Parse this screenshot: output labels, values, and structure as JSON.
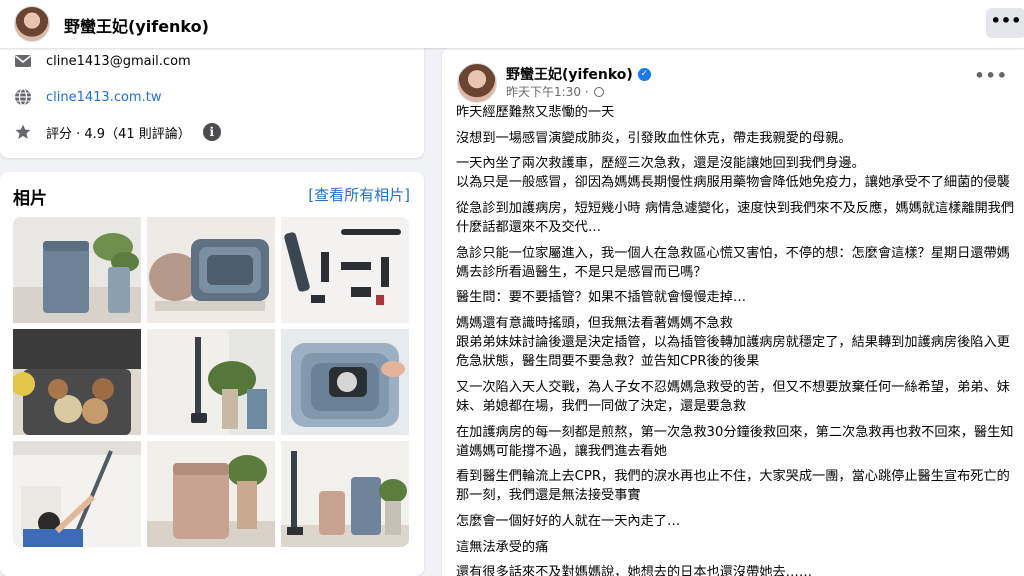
{
  "header": {
    "page_name": "野蠻王妃(yifenko)",
    "more_label": "•••"
  },
  "intro": {
    "email": "cline1413@gmail.com",
    "website": "cline1413.com.tw",
    "rating": "評分 · 4.9（41 則評論）",
    "info_glyph": "i"
  },
  "photos": {
    "title": "相片",
    "see_all": "[查看所有相片]",
    "items": [
      "air-purifier-blue",
      "air-purifier-stack-rose",
      "vacuum-accessories",
      "air-fryer-cookies",
      "stick-vacuum-plants",
      "air-purifier-filter-panel",
      "man-vacuuming-ceiling",
      "air-purifier-pink-plant",
      "vacuum-purifier-group"
    ]
  },
  "post": {
    "author": "野蠻王妃(yifenko)",
    "verified_glyph": "✓",
    "time": "昨天下午1:30 ·",
    "more_label": "•••",
    "paragraphs": [
      "昨天經歷難熬又悲慟的一天",
      "沒想到一場感冒演變成肺炎，引發敗血性休克，帶走我親愛的母親。",
      "一天內坐了兩次救護車，歷經三次急救，還是沒能讓她回到我們身邊。\n以為只是一般感冒，卻因為媽媽長期慢性病服用藥物會降低她免疫力，讓她承受不了細菌的侵襲",
      "從急診到加護病房，短短幾小時 病情急遽變化，速度快到我們來不及反應，媽媽就這樣離開我們\n什麼話都還來不及交代…",
      "急診只能一位家屬進入，我一個人在急救區心慌又害怕，不停的想：怎麼會這樣？星期日還帶媽媽去診所看過醫生，不是只是感冒而已嗎？",
      "醫生問：要不要插管？如果不插管就會慢慢走掉…",
      "媽媽還有意識時搖頭，但我無法看著媽媽不急救\n跟弟弟妹妹討論後還是決定插管，以為插管後轉加護病房就穩定了，結果轉到加護病房後陷入更危急狀態，醫生問要不要急救？並告知CPR後的後果",
      "又一次陷入天人交戰，為人子女不忍媽媽急救受的苦，但又不想要放棄任何一絲希望，弟弟、妹妹、弟媳都在場，我們一同做了決定，還是要急救",
      "在加護病房的每一刻都是煎熬，第一次急救30分鐘後救回來，第二次急救再也救不回來，醫生知道媽媽可能撐不過，讓我們進去看她",
      "看到醫生們輪流上去CPR，我們的淚水再也止不住，大家哭成一團，當心跳停止醫生宣布死亡的那一刻，我們還是無法接受事實",
      "怎麼會一個好好的人就在一天內走了…",
      "這無法承受的痛",
      "還有很多話來不及對媽媽說，她想去的日本也還沒帶她去……"
    ]
  }
}
